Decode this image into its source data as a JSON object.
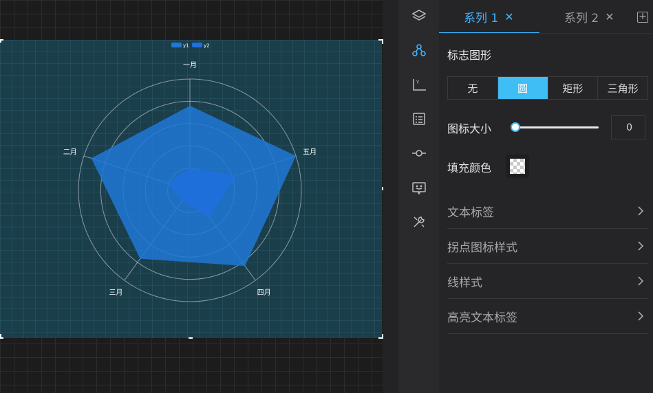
{
  "chart_data": {
    "type": "radar",
    "indicators": [
      "一月",
      "五月",
      "四月",
      "三月",
      "二月"
    ],
    "series": [
      {
        "name": "y1",
        "values": [
          76,
          100,
          84,
          76,
          93
        ],
        "color": "#1e78d6"
      },
      {
        "name": "y2",
        "values": [
          20,
          43,
          30,
          12,
          20
        ],
        "color": "#1f6fde"
      }
    ],
    "max": 100,
    "rings": 5,
    "legend_position": "top-center",
    "colors": {
      "frame_bg": "#1b3e4b",
      "axis_line": "#dfe8ec"
    }
  },
  "rail": {
    "icons": [
      "layers-icon",
      "series-icon",
      "axis-icon",
      "list-icon",
      "dot-line-icon",
      "message-icon",
      "tools-icon"
    ],
    "active": "series-icon"
  },
  "tabs": [
    {
      "label": "系列 1",
      "close": "✕",
      "active": true
    },
    {
      "label": "系列 2",
      "close": "✕",
      "active": false
    }
  ],
  "add_tab": "+",
  "marker": {
    "label": "标志图形",
    "options": [
      "无",
      "圆",
      "矩形",
      "三角形"
    ],
    "selected": "圆"
  },
  "icon_size": {
    "label": "图标大小",
    "value": "0",
    "slider_level": 0
  },
  "fill_color": {
    "label": "填充颜色"
  },
  "sections": [
    "文本标签",
    "拐点图标样式",
    "线样式",
    "高亮文本标签"
  ],
  "colors": {
    "accent": "#3fb5ff",
    "selected_bg": "#3fbdf5"
  }
}
